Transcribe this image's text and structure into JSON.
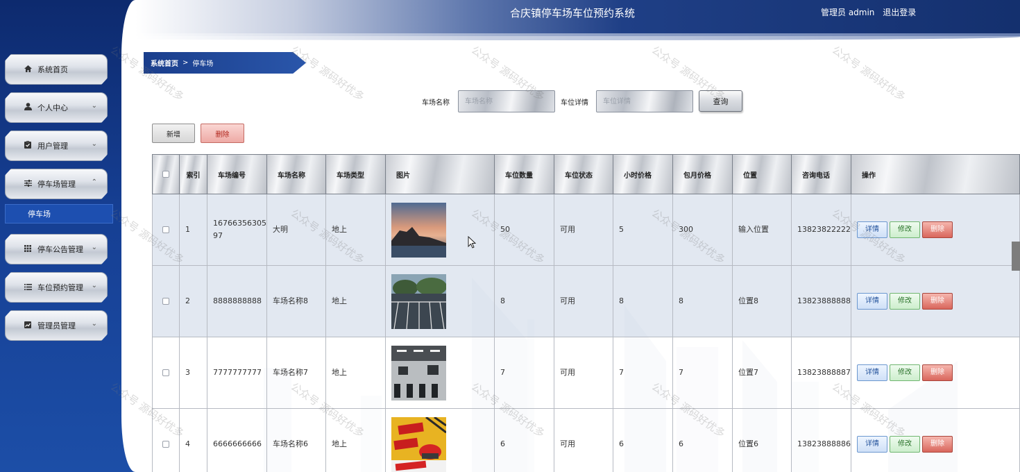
{
  "header": {
    "title": "合庆镇停车场车位预约系统",
    "user_label": "管理员 admin",
    "logout_label": "退出登录"
  },
  "sidebar": {
    "items": [
      {
        "label": "系统首页",
        "icon": "home-icon",
        "has_chevron": false
      },
      {
        "label": "个人中心",
        "icon": "user-icon",
        "has_chevron": true
      },
      {
        "label": "用户管理",
        "icon": "clipboard-icon",
        "has_chevron": true
      },
      {
        "label": "停车场管理",
        "icon": "sliders-icon",
        "has_chevron": true,
        "expanded": true
      },
      {
        "label": "停车公告管理",
        "icon": "grid-icon",
        "has_chevron": true
      },
      {
        "label": "车位预约管理",
        "icon": "list-icon",
        "has_chevron": true
      },
      {
        "label": "管理员管理",
        "icon": "chart-icon",
        "has_chevron": true
      }
    ],
    "submenu": {
      "label": "停车场"
    }
  },
  "breadcrumb": {
    "home": "系统首页",
    "separator": ">",
    "current": "停车场"
  },
  "search": {
    "name_label": "车场名称",
    "name_placeholder": "车场名称",
    "detail_label": "车位详情",
    "detail_placeholder": "车位详情",
    "query_label": "查询"
  },
  "actions": {
    "add_label": "新增",
    "delete_label": "删除"
  },
  "table": {
    "headers": [
      "",
      "索引",
      "车场编号",
      "车场名称",
      "车场类型",
      "图片",
      "车位数量",
      "车位状态",
      "小时价格",
      "包月价格",
      "位置",
      "咨询电话",
      "操作"
    ],
    "row_actions": {
      "detail": "详情",
      "edit": "修改",
      "delete": "删除"
    },
    "rows": [
      {
        "index": "1",
        "code": "1676635630597",
        "name": "大明",
        "type": "地上",
        "image": "sunset-sea-rock-photo",
        "count": "50",
        "status": "可用",
        "hour_price": "5",
        "month_price": "300",
        "location": "输入位置",
        "phone": "13823822222"
      },
      {
        "index": "2",
        "code": "8888888888",
        "name": "车场名称8",
        "type": "地上",
        "image": "outdoor-parking-lot-photo",
        "count": "8",
        "status": "可用",
        "hour_price": "8",
        "month_price": "8",
        "location": "位置8",
        "phone": "13823888888"
      },
      {
        "index": "3",
        "code": "7777777777",
        "name": "车场名称7",
        "type": "地上",
        "image": "underground-garage-photo",
        "count": "7",
        "status": "可用",
        "hour_price": "7",
        "month_price": "7",
        "location": "位置7",
        "phone": "13823888887"
      },
      {
        "index": "4",
        "code": "6666666666",
        "name": "车场名称6",
        "type": "地上",
        "image": "parking-advertisement-photo",
        "count": "6",
        "status": "可用",
        "hour_price": "6",
        "month_price": "6",
        "location": "位置6",
        "phone": "13823888886"
      }
    ]
  },
  "watermark": "公众号 源码好优多",
  "colors": {
    "sidebar_blue": "#163f93",
    "header_dark": "#14306e",
    "delete_red": "#d9665c",
    "edit_green": "#6fb56f",
    "detail_blue": "#6b97cf"
  }
}
